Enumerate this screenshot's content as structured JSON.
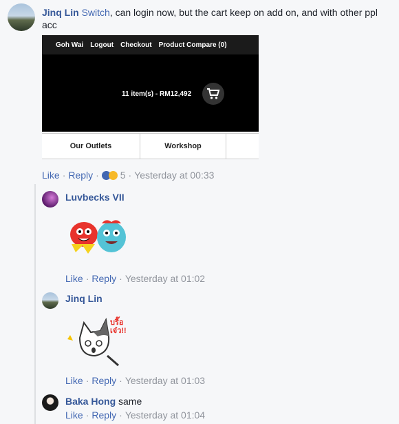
{
  "comment": {
    "author": "Jinq Lin",
    "mention": "Switch",
    "text": ", can login now, but the cart keep on add on, and with other ppl acc",
    "screenshot": {
      "nav": [
        "Goh Wai",
        "Logout",
        "Checkout",
        "Product Compare (0)"
      ],
      "cart_text": "11 item(s) - RM12,492",
      "tabs": [
        "Our Outlets",
        "Workshop"
      ]
    },
    "actions": {
      "like": "Like",
      "reply": "Reply",
      "reaction_count": "5",
      "time": "Yesterday at 00:33"
    }
  },
  "replies": [
    {
      "author": "Luvbecks VII",
      "like": "Like",
      "reply": "Reply",
      "time": "Yesterday at 01:02",
      "sticker": "red-and-blue-monster-sticker"
    },
    {
      "author": "Jinq Lin",
      "like": "Like",
      "reply": "Reply",
      "time": "Yesterday at 01:03",
      "sticker": "cat-sticker",
      "sticker_text": "บรื๊อ เจ๋ว!!"
    },
    {
      "author": "Baka Hong",
      "text": "same",
      "like": "Like",
      "reply": "Reply",
      "time": "Yesterday at 01:04"
    }
  ],
  "colors": {
    "link": "#4267b2",
    "name": "#365899",
    "meta": "#90949c",
    "background": "#f6f7f9"
  }
}
